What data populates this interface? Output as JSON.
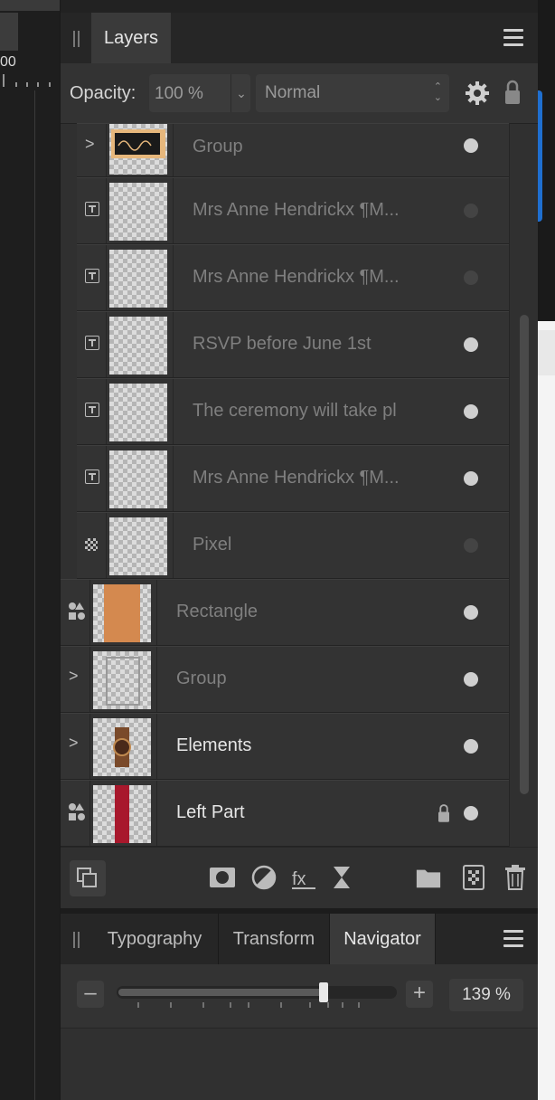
{
  "canvas": {
    "ruler_value": "00"
  },
  "layers_panel": {
    "tab_label": "Layers",
    "opacity_label": "Opacity:",
    "opacity_value": "100 %",
    "blend_mode": "Normal",
    "layers": [
      {
        "name": "Group",
        "kind": "group",
        "visible": true,
        "expandable": true
      },
      {
        "name": "Mrs Anne Hendrickx ¶M...",
        "kind": "text",
        "visible": false
      },
      {
        "name": "Mrs Anne Hendrickx ¶M...",
        "kind": "text",
        "visible": false
      },
      {
        "name": "RSVP before June 1st",
        "kind": "text",
        "visible": true
      },
      {
        "name": "The ceremony will take pl",
        "kind": "text",
        "visible": true
      },
      {
        "name": "Mrs Anne Hendrickx ¶M...",
        "kind": "text",
        "visible": true
      },
      {
        "name": "Pixel",
        "kind": "pixel",
        "visible": false
      },
      {
        "name": "Rectangle",
        "kind": "shape",
        "visible": true,
        "thumb_color": "#d4894f"
      },
      {
        "name": "Group",
        "kind": "group",
        "visible": true,
        "expandable": true
      },
      {
        "name": "Elements",
        "kind": "group",
        "visible": true,
        "expandable": true
      },
      {
        "name": "Left Part",
        "kind": "shape",
        "visible": true,
        "locked": true,
        "thumb_color": "#a8182c"
      }
    ]
  },
  "bottom_panel": {
    "tabs": [
      "Typography",
      "Transform",
      "Navigator"
    ],
    "active_tab": "Navigator",
    "zoom_value": "139 %",
    "zoom_slider_fraction": 0.74
  }
}
